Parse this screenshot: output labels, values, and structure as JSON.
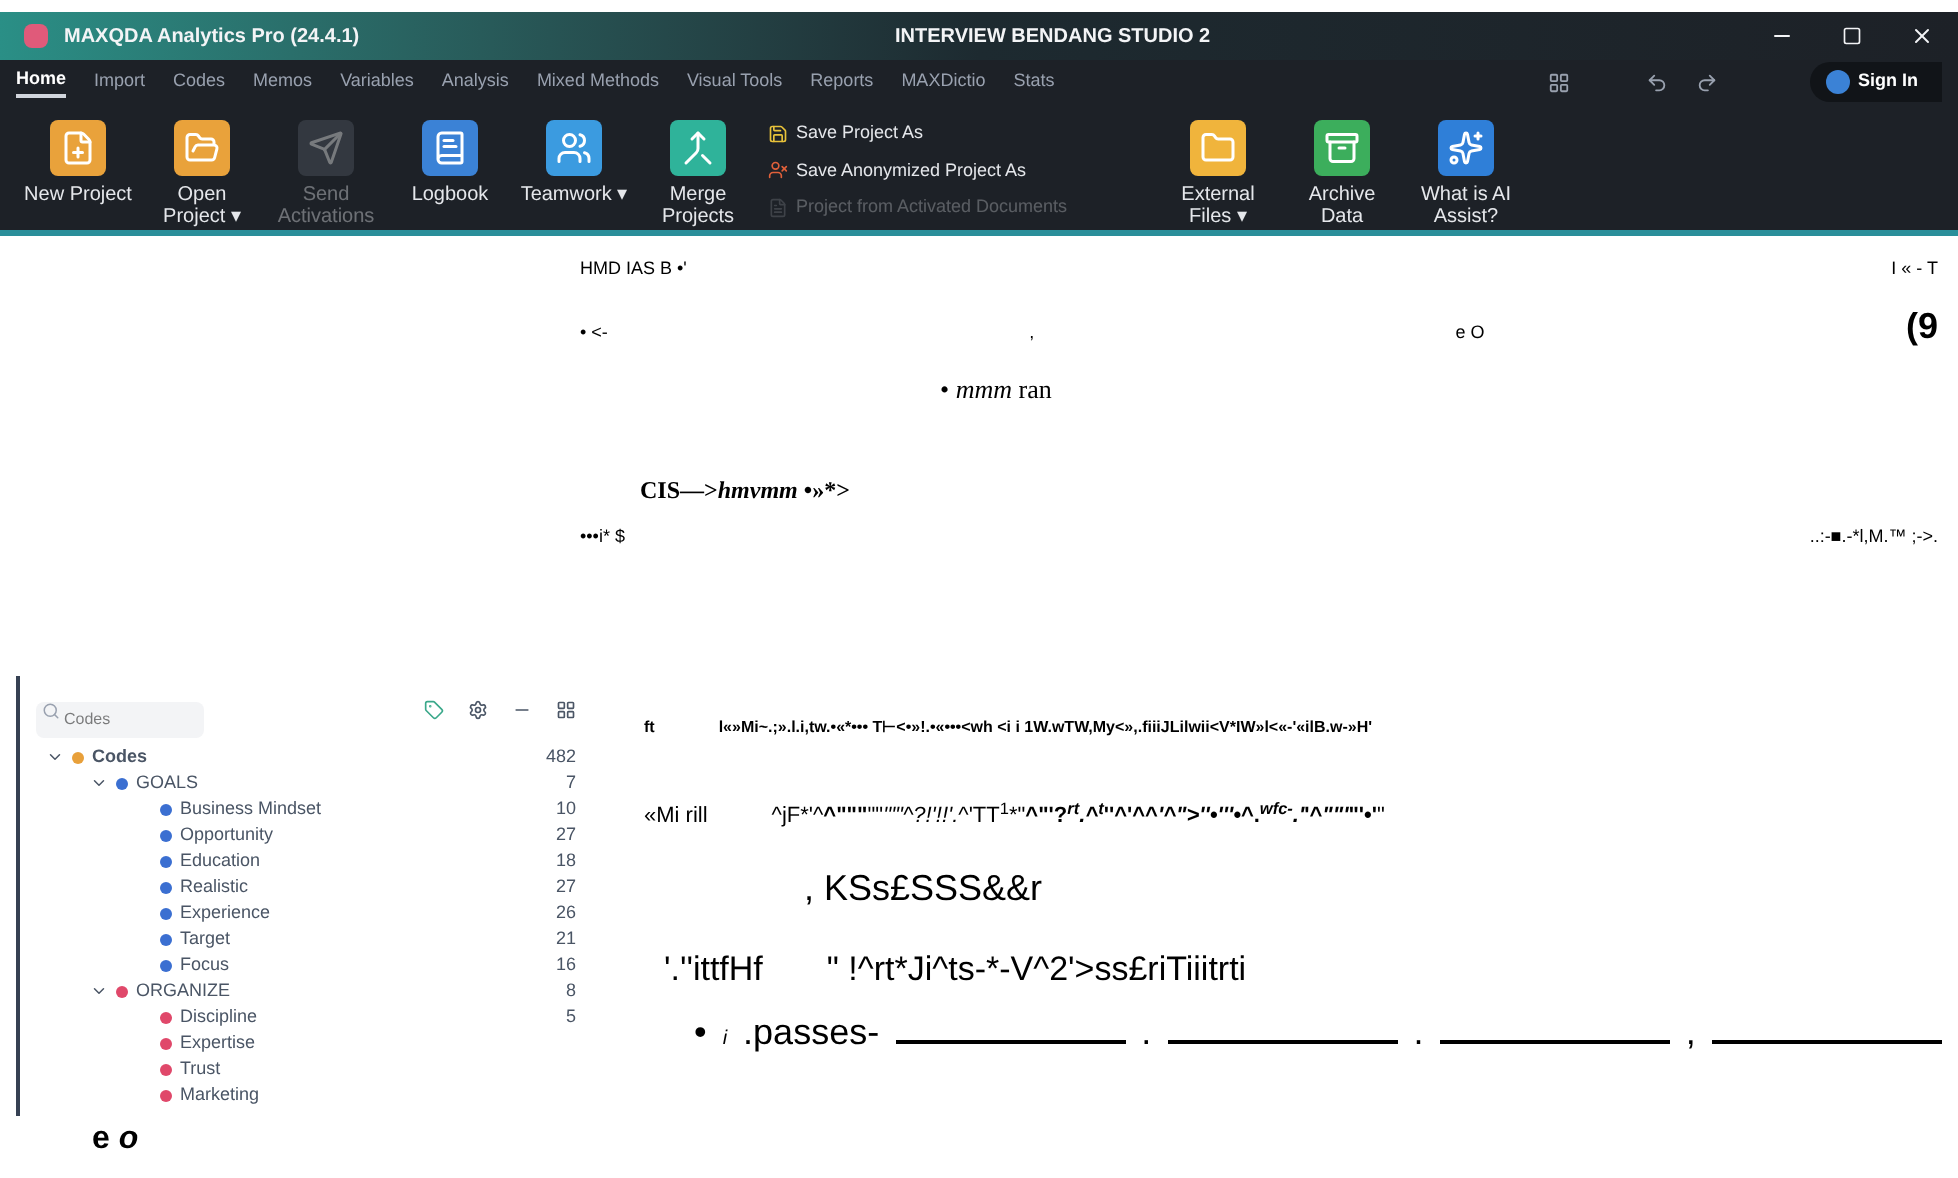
{
  "window": {
    "title": "MAXQDA Analytics Pro (24.4.1)",
    "project": "INTERVIEW BENDANG STUDIO 2"
  },
  "ribbon_tabs": [
    {
      "label": "Home",
      "selected": true
    },
    {
      "label": "Import",
      "selected": false
    },
    {
      "label": "Codes",
      "selected": false
    },
    {
      "label": "Memos",
      "selected": false
    },
    {
      "label": "Variables",
      "selected": false
    },
    {
      "label": "Analysis",
      "selected": false
    },
    {
      "label": "Mixed Methods",
      "selected": false
    },
    {
      "label": "Visual Tools",
      "selected": false
    },
    {
      "label": "Reports",
      "selected": false
    },
    {
      "label": "MAXDictio",
      "selected": false
    },
    {
      "label": "Stats",
      "selected": false
    }
  ],
  "sign_in": "Sign In",
  "ribbon": [
    {
      "kind": "large",
      "label": "New Project",
      "disabled": false
    },
    {
      "kind": "large",
      "label": "Open Project ▾",
      "disabled": false
    },
    {
      "kind": "large",
      "label": "Send Activations",
      "disabled": true
    },
    {
      "kind": "large",
      "label": "Logbook",
      "disabled": false
    },
    {
      "kind": "large",
      "label": "Teamwork ▾",
      "disabled": false
    },
    {
      "kind": "large",
      "label": "Merge Projects",
      "disabled": false
    },
    {
      "kind": "small",
      "items": [
        {
          "label": "Save Project As",
          "disabled": false
        },
        {
          "label": "Save Anonymized Project As",
          "disabled": false
        },
        {
          "label": "Project from Activated Documents",
          "disabled": true
        }
      ]
    },
    {
      "kind": "large",
      "label": "External Files ▾",
      "disabled": false
    },
    {
      "kind": "large",
      "label": "Archive Data",
      "disabled": false
    },
    {
      "kind": "large",
      "label": "What is AI Assist?",
      "disabled": false
    }
  ],
  "scan_lines": [
    {
      "kind": "spread",
      "texts": [
        "HMD IAS B •'",
        "I « - T"
      ]
    },
    {
      "kind": "spread",
      "texts": [
        "• <-",
        ",",
        "e O",
        "(9"
      ]
    },
    {
      "kind": "serif",
      "text": "• *mmm* ran"
    },
    {
      "kind": "serifbold",
      "text": "CIS—>*hmvmm* •»*>"
    },
    {
      "kind": "spread",
      "texts": [
        "•••i* $",
        "..:-■.-*l,M.™ ;->."
      ]
    }
  ],
  "codes": {
    "placeholder": "Codes",
    "tree": [
      {
        "label": "Codes",
        "count": "482",
        "expanded": true,
        "color": "#e8a03a",
        "children": [
          {
            "label": "GOALS",
            "count": "7",
            "expanded": true,
            "color": "#3b6fd1",
            "children": [
              {
                "label": "Business Mindset",
                "count": "10",
                "color": "#3b6fd1"
              },
              {
                "label": "Opportunity",
                "count": "27",
                "color": "#3b6fd1"
              },
              {
                "label": "Education",
                "count": "18",
                "color": "#3b6fd1"
              },
              {
                "label": "Realistic",
                "count": "27",
                "color": "#3b6fd1"
              },
              {
                "label": "Experience",
                "count": "26",
                "color": "#3b6fd1"
              },
              {
                "label": "Target",
                "count": "21",
                "color": "#3b6fd1"
              },
              {
                "label": "Focus",
                "count": "16",
                "color": "#3b6fd1"
              }
            ]
          },
          {
            "label": "ORGANIZE",
            "count": "8",
            "expanded": true,
            "color": "#e0486a",
            "children": [
              {
                "label": "Discipline",
                "count": "5",
                "color": "#e0486a"
              },
              {
                "label": "Expertise",
                "color": "#e0486a"
              },
              {
                "label": "Trust",
                "color": "#e0486a"
              },
              {
                "label": "Marketing",
                "color": "#e0486a"
              }
            ]
          }
        ]
      }
    ]
  },
  "side_lines": [
    {
      "texts": [
        "ft",
        "l«»Mi~.;».l.i,tw.•«*••• T⊢<•»!.•«•••<wh <i i 1W.wTW,My<»,.fiiiJLilwii<V*IW»l<«-'«ilB.w-»H'"
      ]
    },
    {
      "texts": [
        "«Mi rill",
        "^jF*'^**^\"\"\"**\"\"*'\"\"^?!'!!'.*^'TT$^{1}$*\"**^\"'?*$^{rt}$.^$^{t}$*''^'^^*'^\">''•'''•*^.*$^{wfc-}$.'*'^*\"\"'*\"'•'**\""
      ]
    },
    {
      "texts": [
        ", KSs£SSS&&r"
      ]
    },
    {
      "texts": [
        "'.''ittfHf",
        "\" !^rt*Ji^ts-*-V^2'>ss£riTiiitrti"
      ]
    }
  ],
  "passes": {
    "bullet": "•",
    "mark": "i",
    "text": ".passes-",
    "seps": [
      ".",
      ".",
      ","
    ]
  },
  "footer": "e *o*"
}
